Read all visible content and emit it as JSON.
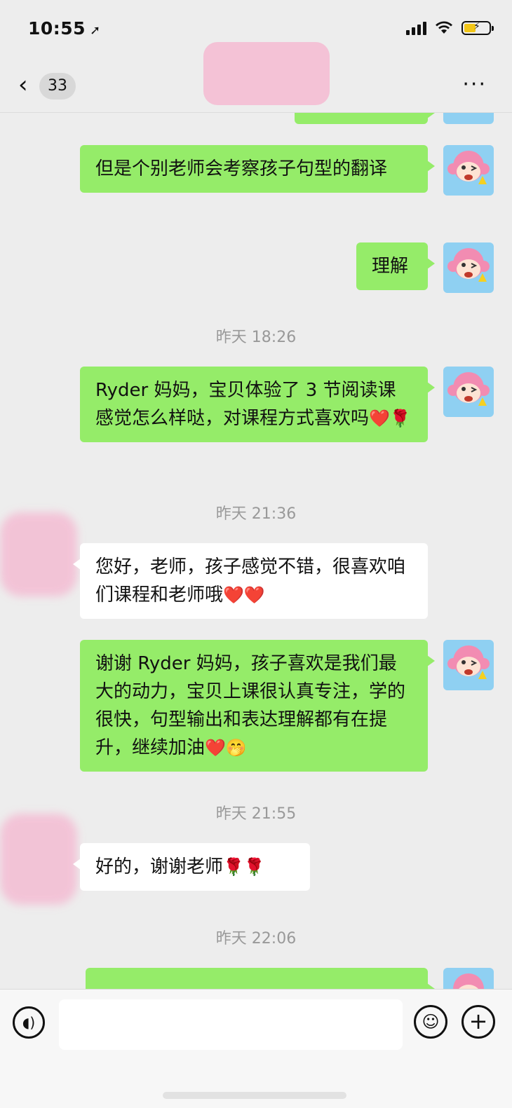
{
  "status_bar": {
    "time": "10:55",
    "location_icon": "location-arrow-icon",
    "signal_icon": "cellular-signal-icon",
    "wifi_icon": "wifi-icon",
    "battery_icon": "battery-charging-icon"
  },
  "nav": {
    "back_icon": "chevron-left-icon",
    "unread_count": "33",
    "title": "",
    "more_icon": "more-dots-icon"
  },
  "messages": [
    {
      "type": "text",
      "side": "me",
      "text": "但是个别老师会考察孩子句型的翻译"
    },
    {
      "type": "text",
      "side": "me",
      "text": "理解"
    },
    {
      "type": "time",
      "text": "昨天 18:26"
    },
    {
      "type": "text",
      "side": "me",
      "text": "Ryder 妈妈，宝贝体验了 3 节阅读课感觉怎么样哒，对课程方式喜欢吗",
      "emojis": "❤️🌹"
    },
    {
      "type": "time",
      "text": "昨天 21:36"
    },
    {
      "type": "text",
      "side": "them",
      "text": "您好，老师，孩子感觉不错，很喜欢咱们课程和老师哦",
      "emojis": "❤️❤️"
    },
    {
      "type": "text",
      "side": "me",
      "text": "谢谢 Ryder 妈妈，孩子喜欢是我们最大的动力，宝贝上课很认真专注，学的很快，句型输出和表达理解都有在提升，继续加油",
      "emojis": "❤️🤭"
    },
    {
      "type": "time",
      "text": "昨天 21:55"
    },
    {
      "type": "text",
      "side": "them",
      "text": "好的，谢谢老师",
      "emojis": "🌹🌹"
    },
    {
      "type": "time",
      "text": "昨天 22:06"
    }
  ],
  "input_bar": {
    "voice_icon": "voice-icon",
    "emoji_icon": "emoji-face-icon",
    "plus_icon": "plus-circle-icon",
    "input_value": ""
  },
  "colors": {
    "background": "#ededed",
    "my_bubble": "#95ec69",
    "their_bubble": "#ffffff",
    "timestamp": "#999999",
    "redaction": "#f4bcd3"
  }
}
